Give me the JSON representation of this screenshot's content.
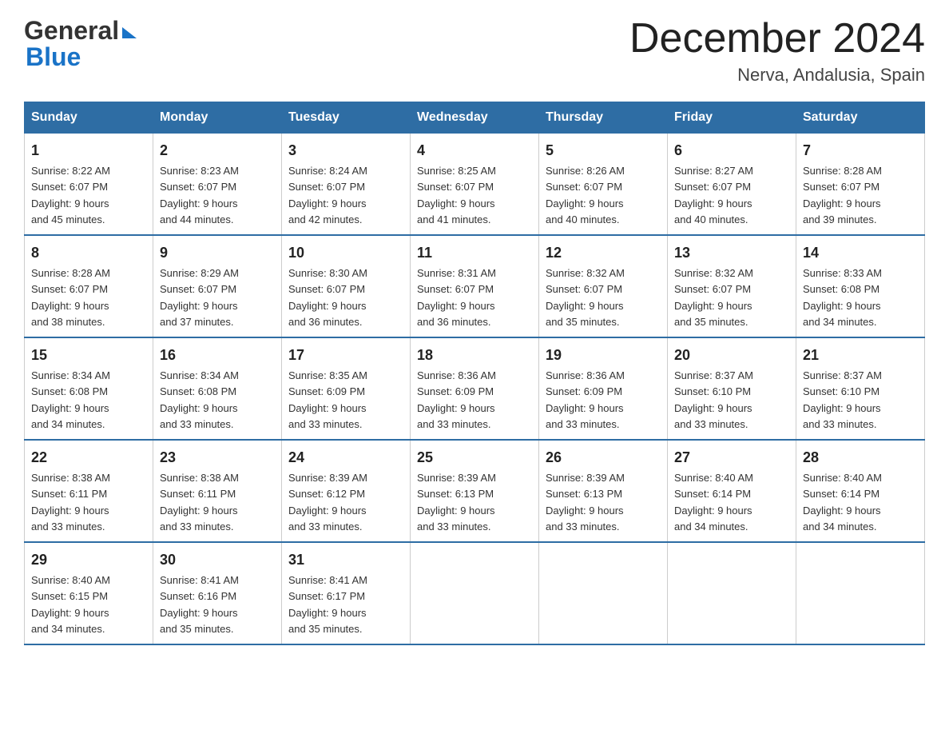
{
  "logo": {
    "general": "General",
    "blue": "Blue"
  },
  "header": {
    "title": "December 2024",
    "subtitle": "Nerva, Andalusia, Spain"
  },
  "days_header": [
    "Sunday",
    "Monday",
    "Tuesday",
    "Wednesday",
    "Thursday",
    "Friday",
    "Saturday"
  ],
  "weeks": [
    [
      {
        "day": "1",
        "sunrise": "8:22 AM",
        "sunset": "6:07 PM",
        "daylight": "9 hours and 45 minutes."
      },
      {
        "day": "2",
        "sunrise": "8:23 AM",
        "sunset": "6:07 PM",
        "daylight": "9 hours and 44 minutes."
      },
      {
        "day": "3",
        "sunrise": "8:24 AM",
        "sunset": "6:07 PM",
        "daylight": "9 hours and 42 minutes."
      },
      {
        "day": "4",
        "sunrise": "8:25 AM",
        "sunset": "6:07 PM",
        "daylight": "9 hours and 41 minutes."
      },
      {
        "day": "5",
        "sunrise": "8:26 AM",
        "sunset": "6:07 PM",
        "daylight": "9 hours and 40 minutes."
      },
      {
        "day": "6",
        "sunrise": "8:27 AM",
        "sunset": "6:07 PM",
        "daylight": "9 hours and 40 minutes."
      },
      {
        "day": "7",
        "sunrise": "8:28 AM",
        "sunset": "6:07 PM",
        "daylight": "9 hours and 39 minutes."
      }
    ],
    [
      {
        "day": "8",
        "sunrise": "8:28 AM",
        "sunset": "6:07 PM",
        "daylight": "9 hours and 38 minutes."
      },
      {
        "day": "9",
        "sunrise": "8:29 AM",
        "sunset": "6:07 PM",
        "daylight": "9 hours and 37 minutes."
      },
      {
        "day": "10",
        "sunrise": "8:30 AM",
        "sunset": "6:07 PM",
        "daylight": "9 hours and 36 minutes."
      },
      {
        "day": "11",
        "sunrise": "8:31 AM",
        "sunset": "6:07 PM",
        "daylight": "9 hours and 36 minutes."
      },
      {
        "day": "12",
        "sunrise": "8:32 AM",
        "sunset": "6:07 PM",
        "daylight": "9 hours and 35 minutes."
      },
      {
        "day": "13",
        "sunrise": "8:32 AM",
        "sunset": "6:07 PM",
        "daylight": "9 hours and 35 minutes."
      },
      {
        "day": "14",
        "sunrise": "8:33 AM",
        "sunset": "6:08 PM",
        "daylight": "9 hours and 34 minutes."
      }
    ],
    [
      {
        "day": "15",
        "sunrise": "8:34 AM",
        "sunset": "6:08 PM",
        "daylight": "9 hours and 34 minutes."
      },
      {
        "day": "16",
        "sunrise": "8:34 AM",
        "sunset": "6:08 PM",
        "daylight": "9 hours and 33 minutes."
      },
      {
        "day": "17",
        "sunrise": "8:35 AM",
        "sunset": "6:09 PM",
        "daylight": "9 hours and 33 minutes."
      },
      {
        "day": "18",
        "sunrise": "8:36 AM",
        "sunset": "6:09 PM",
        "daylight": "9 hours and 33 minutes."
      },
      {
        "day": "19",
        "sunrise": "8:36 AM",
        "sunset": "6:09 PM",
        "daylight": "9 hours and 33 minutes."
      },
      {
        "day": "20",
        "sunrise": "8:37 AM",
        "sunset": "6:10 PM",
        "daylight": "9 hours and 33 minutes."
      },
      {
        "day": "21",
        "sunrise": "8:37 AM",
        "sunset": "6:10 PM",
        "daylight": "9 hours and 33 minutes."
      }
    ],
    [
      {
        "day": "22",
        "sunrise": "8:38 AM",
        "sunset": "6:11 PM",
        "daylight": "9 hours and 33 minutes."
      },
      {
        "day": "23",
        "sunrise": "8:38 AM",
        "sunset": "6:11 PM",
        "daylight": "9 hours and 33 minutes."
      },
      {
        "day": "24",
        "sunrise": "8:39 AM",
        "sunset": "6:12 PM",
        "daylight": "9 hours and 33 minutes."
      },
      {
        "day": "25",
        "sunrise": "8:39 AM",
        "sunset": "6:13 PM",
        "daylight": "9 hours and 33 minutes."
      },
      {
        "day": "26",
        "sunrise": "8:39 AM",
        "sunset": "6:13 PM",
        "daylight": "9 hours and 33 minutes."
      },
      {
        "day": "27",
        "sunrise": "8:40 AM",
        "sunset": "6:14 PM",
        "daylight": "9 hours and 34 minutes."
      },
      {
        "day": "28",
        "sunrise": "8:40 AM",
        "sunset": "6:14 PM",
        "daylight": "9 hours and 34 minutes."
      }
    ],
    [
      {
        "day": "29",
        "sunrise": "8:40 AM",
        "sunset": "6:15 PM",
        "daylight": "9 hours and 34 minutes."
      },
      {
        "day": "30",
        "sunrise": "8:41 AM",
        "sunset": "6:16 PM",
        "daylight": "9 hours and 35 minutes."
      },
      {
        "day": "31",
        "sunrise": "8:41 AM",
        "sunset": "6:17 PM",
        "daylight": "9 hours and 35 minutes."
      },
      null,
      null,
      null,
      null
    ]
  ],
  "labels": {
    "sunrise": "Sunrise:",
    "sunset": "Sunset:",
    "daylight": "Daylight:"
  },
  "colors": {
    "header_bg": "#2e6da4",
    "border_blue": "#2e6da4"
  }
}
